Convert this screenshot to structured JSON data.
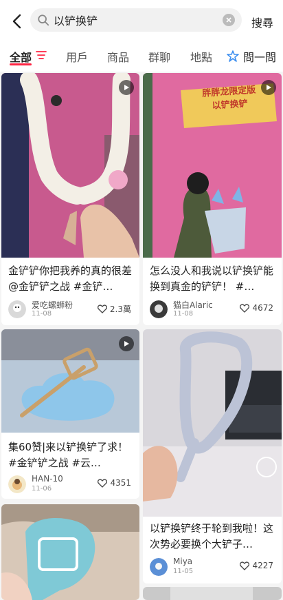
{
  "search": {
    "query": "以铲换铲",
    "button": "搜尋"
  },
  "tabs": [
    {
      "label": "全部"
    },
    {
      "label": "用戶"
    },
    {
      "label": "商品"
    },
    {
      "label": "群聊"
    },
    {
      "label": "地點"
    }
  ],
  "ask": {
    "label": "問一問"
  },
  "overlay_text": {
    "banner_line1": "胖胖龙限定版",
    "banner_line2": "以铲换铲"
  },
  "cards": [
    {
      "caption": "金铲铲你把我养的真的很差@金铲铲之战 #金铲…",
      "user": "爱吃螺蛳粉",
      "date": "11-08",
      "likes": "2.3萬"
    },
    {
      "caption": "怎么没人和我说以铲换铲能换到真金的铲铲！ #…",
      "user": "猫白Alaric",
      "date": "11-08",
      "likes": "4672"
    },
    {
      "caption": "集60赞|来以铲换铲了求！ #金铲铲之战 #云…",
      "user": "HAN-10",
      "date": "11-06",
      "likes": "4351"
    },
    {
      "caption": "以铲换铲终于轮到我啦！这次势必要换个大铲子…",
      "user": "Miya",
      "date": "11-05",
      "likes": "4227"
    }
  ],
  "colors": {
    "accent": "#ff2442",
    "ask_icon": "#3b8ef0"
  }
}
